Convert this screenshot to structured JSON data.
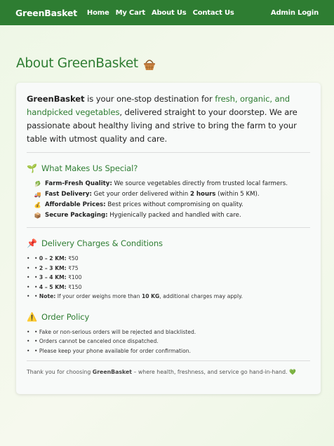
{
  "nav": {
    "brand": "GreenBasket",
    "links": [
      "Home",
      "My Cart",
      "About Us",
      "Contact Us"
    ],
    "admin": "Admin Login"
  },
  "title": "About GreenBasket",
  "intro": {
    "brand": "GreenBasket",
    "text1": " is your one-stop destination for ",
    "highlight": "fresh, organic, and handpicked vegetables",
    "text2": ", delivered straight to your doorstep. We are passionate about healthy living and strive to bring the farm to your table with utmost quality and care."
  },
  "special": {
    "heading": "What Makes Us Special?",
    "items": [
      {
        "label": "Farm-Fresh Quality:",
        "text": " We source vegetables directly from trusted local farmers."
      },
      {
        "label": "Fast Delivery:",
        "text_before": " Get your order delivered within ",
        "bold": "2 hours",
        "text_after": " (within 5 KM)."
      },
      {
        "label": "Affordable Prices:",
        "text": " Best prices without compromising on quality."
      },
      {
        "label": "Secure Packaging:",
        "text": " Hygienically packed and handled with care."
      }
    ]
  },
  "delivery": {
    "heading": "Delivery Charges & Conditions",
    "items": [
      {
        "label": "0 – 2 KM:",
        "text": " ₹50"
      },
      {
        "label": "2 – 3 KM:",
        "text": " ₹75"
      },
      {
        "label": "3 – 4 KM:",
        "text": " ₹100"
      },
      {
        "label": "4 – 5 KM:",
        "text": " ₹150"
      }
    ],
    "note": {
      "label": "Note:",
      "text_before": " If your order weighs more than ",
      "bold": "10 KG",
      "text_after": ", additional charges may apply."
    }
  },
  "policy": {
    "heading": "Order Policy",
    "items": [
      "Fake or non-serious orders will be rejected and blacklisted.",
      "Orders cannot be canceled once dispatched.",
      "Please keep your phone available for order confirmation."
    ]
  },
  "footer": {
    "text1": "Thank you for choosing ",
    "brand": "GreenBasket",
    "text2": " – where health, freshness, and service go hand-in-hand."
  },
  "colors": {
    "brand_green": "#2e7d32",
    "background": "#eef7e6"
  }
}
